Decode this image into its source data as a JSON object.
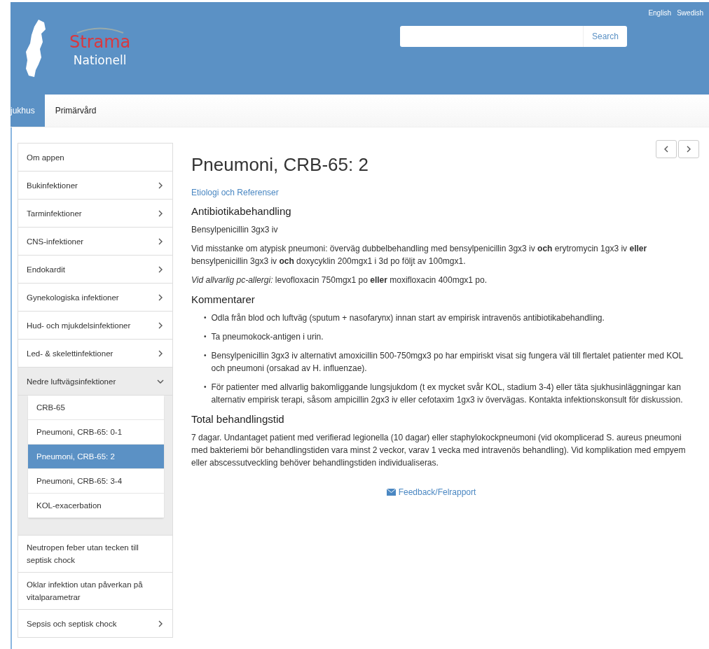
{
  "header": {
    "logo": {
      "name": "Strama",
      "subtitle": "Nationell"
    },
    "languages": [
      "English",
      "Swedish"
    ],
    "search": {
      "button": "Search"
    }
  },
  "tabs": [
    {
      "label": "jukhus",
      "selected": true
    },
    {
      "label": "Primärvård",
      "selected": false
    }
  ],
  "sidebar": {
    "items": [
      {
        "label": "Om appen",
        "kind": "leaf"
      },
      {
        "label": "Bukinfektioner",
        "kind": "folder",
        "expanded": false
      },
      {
        "label": "Tarminfektioner",
        "kind": "folder",
        "expanded": false
      },
      {
        "label": "CNS-infektioner",
        "kind": "folder",
        "expanded": false
      },
      {
        "label": "Endokardit",
        "kind": "folder",
        "expanded": false
      },
      {
        "label": "Gynekologiska infektioner",
        "kind": "folder",
        "expanded": false
      },
      {
        "label": "Hud- och mjukdelsinfektioner",
        "kind": "folder",
        "expanded": false
      },
      {
        "label": "Led- & skelettinfektioner",
        "kind": "folder",
        "expanded": false
      },
      {
        "label": "Nedre luftvägsinfektioner",
        "kind": "folder",
        "expanded": true,
        "children": [
          {
            "label": "CRB-65",
            "selected": false
          },
          {
            "label": "Pneumoni, CRB-65: 0-1",
            "selected": false
          },
          {
            "label": "Pneumoni, CRB-65: 2",
            "selected": true
          },
          {
            "label": "Pneumoni, CRB-65: 3-4",
            "selected": false
          },
          {
            "label": "KOL-exacerbation",
            "selected": false
          }
        ]
      },
      {
        "label": "Neutropen feber utan tecken till septisk chock",
        "kind": "leaf"
      },
      {
        "label": "Oklar infektion utan påverkan på vitalparametrar",
        "kind": "leaf"
      },
      {
        "label": "Sepsis och septisk chock",
        "kind": "folder",
        "expanded": false
      }
    ]
  },
  "article": {
    "title": "Pneumoni, CRB-65: 2",
    "link": "Etiologi och Referenser",
    "sections": [
      {
        "heading": "Antibiotikabehandling",
        "blocks": [
          {
            "kind": "paragraph",
            "text": "Bensylpenicillin 3gx3 iv"
          },
          {
            "kind": "paragraph",
            "text": "Vid misstanke om atypisk pneumoni: överväg dubbelbehandling med bensylpenicillin 3gx3 iv **och** erytromycin 1gx3 iv **eller** bensylpenicillin 3gx3 iv **och** doxycyklin 200mgx1 i 3d po följt av 100mgx1."
          },
          {
            "kind": "paragraph",
            "text": "*Vid allvarlig pc-allergi:* levofloxacin 750mgx1 po **eller** moxifloxacin 400mgx1 po."
          }
        ]
      },
      {
        "heading": "Kommentarer",
        "blocks": [
          {
            "kind": "list",
            "marker": "•",
            "items": [
              "Odla från blod och luftväg (sputum + nasofarynx) innan start av empirisk intravenös antibiotikabehandling.",
              "Ta pneumokock-antigen i urin.",
              "Bensylpenicillin 3gx3 iv alternativt amoxicillin 500-750mgx3 po har empiriskt visat sig fungera väl till flertalet patienter med KOL och pneumoni (orsakad av H. influenzae).",
              "För patienter med allvarlig bakomliggande lungsjukdom (t ex mycket svår KOL, stadium 3-4) eller täta sjukhusinläggningar kan alternativ empirisk terapi, såsom ampicillin 2gx3 iv eller cefotaxim 1gx3 iv övervägas. Kontakta infektionskonsult för diskussion."
            ]
          }
        ]
      },
      {
        "heading": "Total behandlingstid",
        "blocks": [
          {
            "kind": "paragraph",
            "text": "7 dagar. Undantaget patient med verifierad legionella (10 dagar) eller staphylokockpneumoni (vid okomplicerad S. aureus pneumoni med bakteriemi bör behandlingstiden vara minst 2 veckor, varav 1 vecka med intravenös behandling). Vid komplikation med empyem eller abscessutveckling behöver behandlingstiden individualiseras."
          }
        ]
      }
    ],
    "feedback": "Feedback/Felrapport"
  }
}
